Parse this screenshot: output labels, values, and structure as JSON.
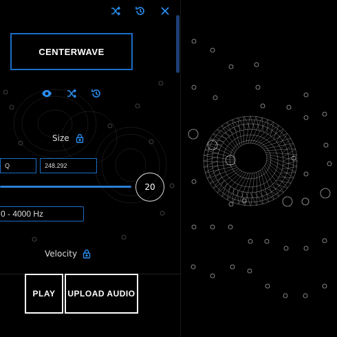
{
  "toolbar": {
    "icons": [
      "shuffle-icon",
      "history-icon",
      "close-icon"
    ]
  },
  "main_button": {
    "label": "CENTERWAVE"
  },
  "view_icons": [
    "eye-icon",
    "shuffle-icon",
    "history-icon"
  ],
  "size": {
    "label": "Size",
    "lock_icon": "lock-icon",
    "input_a": "Q",
    "input_b": "248.292"
  },
  "slider": {
    "value_label": "20",
    "fill_fraction": 0.9
  },
  "frequency": {
    "value": "0 - 4000 Hz"
  },
  "velocity": {
    "label": "Velocity",
    "lock_icon": "lock-icon"
  },
  "actions": {
    "play_label": "PLAY",
    "upload_label": "UPLOAD AUDIO"
  },
  "colors": {
    "accent": "#2b8ef0",
    "background": "#000000",
    "border": "#1a6ec8"
  }
}
